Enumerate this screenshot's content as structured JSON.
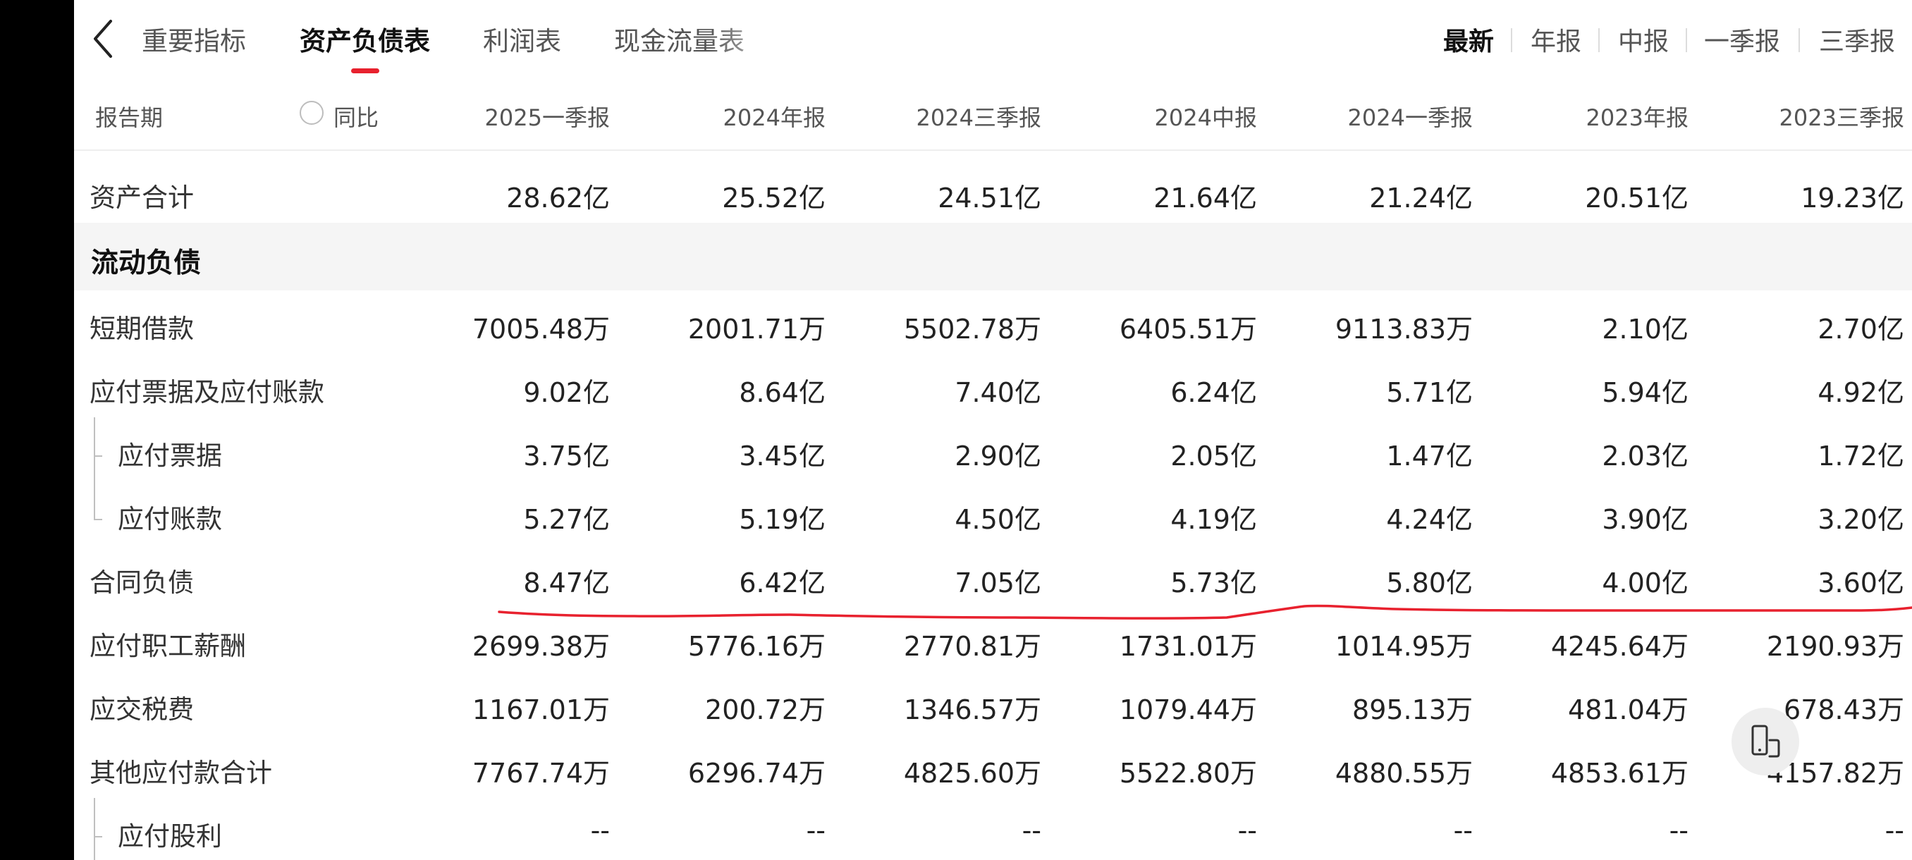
{
  "nav": {
    "tabs": [
      {
        "label": "重要指标",
        "active": false
      },
      {
        "label": "资产负债表",
        "active": true
      },
      {
        "label": "利润表",
        "active": false
      },
      {
        "label": "现金流量表",
        "active": false
      }
    ],
    "periods": [
      {
        "label": "最新",
        "active": true
      },
      {
        "label": "年报",
        "active": false
      },
      {
        "label": "中报",
        "active": false
      },
      {
        "label": "一季报",
        "active": false
      },
      {
        "label": "三季报",
        "active": false
      }
    ],
    "back_icon": "chevron-left-icon",
    "accent_color": "#e8212e"
  },
  "table": {
    "period_label": "报告期",
    "yoy_label": "同比",
    "columns": [
      "2025一季报",
      "2024年报",
      "2024三季报",
      "2024中报",
      "2024一季报",
      "2023年报",
      "2023三季报"
    ],
    "rows": [
      {
        "label": "资产合计",
        "type": "item",
        "values": [
          "28.62亿",
          "25.52亿",
          "24.51亿",
          "21.64亿",
          "21.24亿",
          "20.51亿",
          "19.23亿"
        ]
      },
      {
        "label": "流动负债",
        "type": "section",
        "values": []
      },
      {
        "label": "短期借款",
        "type": "item",
        "values": [
          "7005.48万",
          "2001.71万",
          "5502.78万",
          "6405.51万",
          "9113.83万",
          "2.10亿",
          "2.70亿"
        ]
      },
      {
        "label": "应付票据及应付账款",
        "type": "item",
        "values": [
          "9.02亿",
          "8.64亿",
          "7.40亿",
          "6.24亿",
          "5.71亿",
          "5.94亿",
          "4.92亿"
        ]
      },
      {
        "label": "应付票据",
        "type": "child",
        "values": [
          "3.75亿",
          "3.45亿",
          "2.90亿",
          "2.05亿",
          "1.47亿",
          "2.03亿",
          "1.72亿"
        ]
      },
      {
        "label": "应付账款",
        "type": "child-last",
        "values": [
          "5.27亿",
          "5.19亿",
          "4.50亿",
          "4.19亿",
          "4.24亿",
          "3.90亿",
          "3.20亿"
        ]
      },
      {
        "label": "合同负债",
        "type": "item",
        "values": [
          "8.47亿",
          "6.42亿",
          "7.05亿",
          "5.73亿",
          "5.80亿",
          "4.00亿",
          "3.60亿"
        ]
      },
      {
        "label": "应付职工薪酬",
        "type": "item",
        "values": [
          "2699.38万",
          "5776.16万",
          "2770.81万",
          "1731.01万",
          "1014.95万",
          "4245.64万",
          "2190.93万"
        ]
      },
      {
        "label": "应交税费",
        "type": "item",
        "values": [
          "1167.01万",
          "200.72万",
          "1346.57万",
          "1079.44万",
          "895.13万",
          "481.04万",
          "678.43万"
        ]
      },
      {
        "label": "其他应付款合计",
        "type": "item",
        "values": [
          "7767.74万",
          "6296.74万",
          "4825.60万",
          "5522.80万",
          "4880.55万",
          "4853.61万",
          "4157.82万"
        ]
      },
      {
        "label": "应付股利",
        "type": "child",
        "values": [
          "--",
          "--",
          "--",
          "--",
          "--",
          "--",
          "--"
        ]
      }
    ]
  },
  "annotation": {
    "color": "#e8212e"
  },
  "float_button": {
    "icon": "device-rotate-icon"
  }
}
